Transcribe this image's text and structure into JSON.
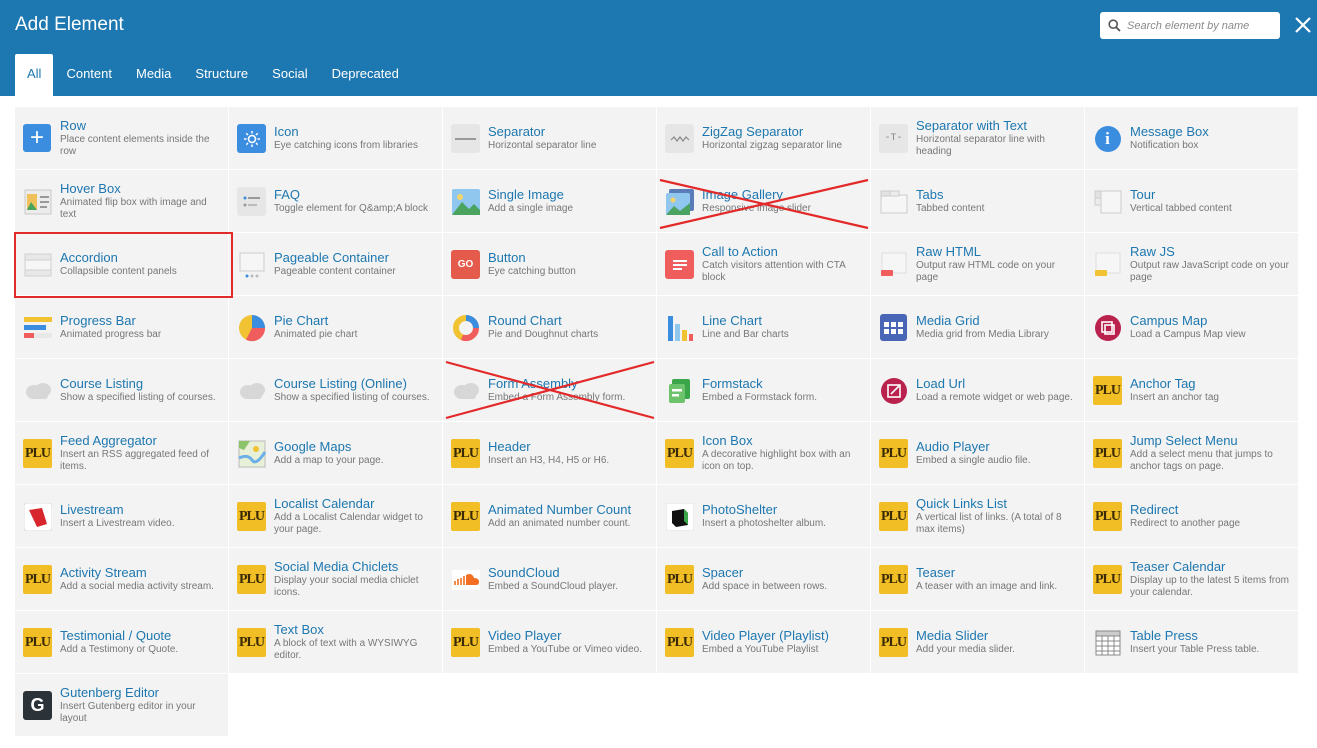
{
  "header": {
    "title": "Add Element",
    "search_placeholder": "Search element by name",
    "tabs": [
      {
        "label": "All",
        "active": true
      },
      {
        "label": "Content"
      },
      {
        "label": "Media"
      },
      {
        "label": "Structure"
      },
      {
        "label": "Social"
      },
      {
        "label": "Deprecated"
      }
    ]
  },
  "elements": [
    {
      "name": "Row",
      "desc": "Place content elements inside the row",
      "icon": "plus-icon"
    },
    {
      "name": "Icon",
      "desc": "Eye catching icons from libraries",
      "icon": "sun-icon"
    },
    {
      "name": "Separator",
      "desc": "Horizontal separator line",
      "icon": "separator-icon"
    },
    {
      "name": "ZigZag Separator",
      "desc": "Horizontal zigzag separator line",
      "icon": "zigzag-icon"
    },
    {
      "name": "Separator with Text",
      "desc": "Horizontal separator line with heading",
      "icon": "text-separator-icon"
    },
    {
      "name": "Message Box",
      "desc": "Notification box",
      "icon": "info-icon"
    },
    {
      "name": "Hover Box",
      "desc": "Animated flip box with image and text",
      "icon": "hover-box-icon"
    },
    {
      "name": "FAQ",
      "desc": "Toggle element for Q&amp;A block",
      "icon": "faq-icon"
    },
    {
      "name": "Single Image",
      "desc": "Add a single image",
      "icon": "image-icon"
    },
    {
      "name": "Image Gallery",
      "desc": "Responsive image slider",
      "icon": "gallery-icon"
    },
    {
      "name": "Tabs",
      "desc": "Tabbed content",
      "icon": "tabs-icon"
    },
    {
      "name": "Tour",
      "desc": "Vertical tabbed content",
      "icon": "tour-icon"
    },
    {
      "name": "Accordion",
      "desc": "Collapsible content panels",
      "icon": "accordion-icon"
    },
    {
      "name": "Pageable Container",
      "desc": "Pageable content container",
      "icon": "pageable-icon"
    },
    {
      "name": "Button",
      "desc": "Eye catching button",
      "icon": "go-button-icon",
      "icon_text": "GO"
    },
    {
      "name": "Call to Action",
      "desc": "Catch visitors attention with CTA block",
      "icon": "cta-icon"
    },
    {
      "name": "Raw HTML",
      "desc": "Output raw HTML code on your page",
      "icon": "raw-html-icon"
    },
    {
      "name": "Raw JS",
      "desc": "Output raw JavaScript code on your page",
      "icon": "raw-js-icon"
    },
    {
      "name": "Progress Bar",
      "desc": "Animated progress bar",
      "icon": "progress-bar-icon"
    },
    {
      "name": "Pie Chart",
      "desc": "Animated pie chart",
      "icon": "pie-chart-icon"
    },
    {
      "name": "Round Chart",
      "desc": "Pie and Doughnut charts",
      "icon": "round-chart-icon"
    },
    {
      "name": "Line Chart",
      "desc": "Line and Bar charts",
      "icon": "bar-chart-icon"
    },
    {
      "name": "Media Grid",
      "desc": "Media grid from Media Library",
      "icon": "media-grid-icon"
    },
    {
      "name": "Campus Map",
      "desc": "Load a Campus Map view",
      "icon": "campus-map-icon"
    },
    {
      "name": "Course Listing",
      "desc": "Show a specified listing of courses.",
      "icon": "cloud-icon"
    },
    {
      "name": "Course Listing (Online)",
      "desc": "Show a specified listing of courses.",
      "icon": "cloud-icon"
    },
    {
      "name": "Form Assembly",
      "desc": "Embed a Form Assembly form.",
      "icon": "cloud-icon"
    },
    {
      "name": "Formstack",
      "desc": "Embed a Formstack form.",
      "icon": "formstack-icon"
    },
    {
      "name": "Load Url",
      "desc": "Load a remote widget or web page.",
      "icon": "load-url-icon"
    },
    {
      "name": "Anchor Tag",
      "desc": "Insert an anchor tag",
      "icon": "plu-logo-icon"
    },
    {
      "name": "Feed Aggregator",
      "desc": "Insert an RSS aggregated feed of items.",
      "icon": "plu-logo-icon"
    },
    {
      "name": "Google Maps",
      "desc": "Add a map to your page.",
      "icon": "map-icon"
    },
    {
      "name": "Header",
      "desc": "Insert an H3, H4, H5 or H6.",
      "icon": "plu-logo-icon"
    },
    {
      "name": "Icon Box",
      "desc": "A decorative highlight box with an icon on top.",
      "icon": "plu-logo-icon"
    },
    {
      "name": "Audio Player",
      "desc": "Embed a single audio file.",
      "icon": "plu-logo-icon"
    },
    {
      "name": "Jump Select Menu",
      "desc": "Add a select menu that jumps to anchor tags on page.",
      "icon": "plu-logo-icon"
    },
    {
      "name": "Livestream",
      "desc": "Insert a Livestream video.",
      "icon": "livestream-icon"
    },
    {
      "name": "Localist Calendar",
      "desc": "Add a Localist Calendar widget to your page.",
      "icon": "plu-logo-icon"
    },
    {
      "name": "Animated Number Count",
      "desc": "Add an animated number count.",
      "icon": "plu-logo-icon"
    },
    {
      "name": "PhotoShelter",
      "desc": "Insert a photoshelter album.",
      "icon": "photoshelter-icon"
    },
    {
      "name": "Quick Links List",
      "desc": "A vertical list of links. (A total of 8 max items)",
      "icon": "plu-logo-icon"
    },
    {
      "name": "Redirect",
      "desc": "Redirect to another page",
      "icon": "plu-logo-icon"
    },
    {
      "name": "Activity Stream",
      "desc": "Add a social media activity stream.",
      "icon": "plu-logo-icon"
    },
    {
      "name": "Social Media Chiclets",
      "desc": "Display your social media chiclet icons.",
      "icon": "plu-logo-icon"
    },
    {
      "name": "SoundCloud",
      "desc": "Embed a SoundCloud player.",
      "icon": "soundcloud-icon"
    },
    {
      "name": "Spacer",
      "desc": "Add space in between rows.",
      "icon": "plu-logo-icon"
    },
    {
      "name": "Teaser",
      "desc": "A teaser with an image and link.",
      "icon": "plu-logo-icon"
    },
    {
      "name": "Teaser Calendar",
      "desc": "Display up to the latest 5 items from your calendar.",
      "icon": "plu-logo-icon"
    },
    {
      "name": "Testimonial / Quote",
      "desc": "Add a Testimony or Quote.",
      "icon": "plu-logo-icon"
    },
    {
      "name": "Text Box",
      "desc": "A block of text with a WYSIWYG editor.",
      "icon": "plu-logo-icon"
    },
    {
      "name": "Video Player",
      "desc": "Embed a YouTube or Vimeo video.",
      "icon": "plu-logo-icon"
    },
    {
      "name": "Video Player (Playlist)",
      "desc": "Embed a YouTube Playlist",
      "icon": "plu-logo-icon"
    },
    {
      "name": "Media Slider",
      "desc": "Add your media slider.",
      "icon": "plu-logo-icon"
    },
    {
      "name": "Table Press",
      "desc": "Insert your Table Press table.",
      "icon": "table-icon"
    },
    {
      "name": "Gutenberg Editor",
      "desc": "Insert Gutenberg editor in your layout",
      "icon": "gutenberg-icon",
      "icon_text": "G"
    }
  ],
  "plu_logo_text": "PLU",
  "colors": {
    "header_bg": "#1d77b0",
    "link": "#1d77b0",
    "cell_bg": "#f3f3f3",
    "annotation_red": "#e32a2a",
    "plu_gold": "#f1be25"
  },
  "annotations": {
    "highlighted_box": "Accordion",
    "crossed_out": [
      "Image Gallery",
      "Form Assembly"
    ]
  }
}
